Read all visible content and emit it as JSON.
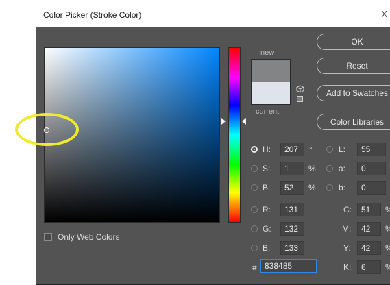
{
  "window": {
    "title": "Color Picker (Stroke Color)",
    "close_glyph": "X"
  },
  "swatches": {
    "new_label": "new",
    "current_label": "current",
    "new_color": "#838485",
    "current_color": "#dfe4ec"
  },
  "buttons": {
    "ok": "OK",
    "reset": "Reset",
    "add_to_swatches": "Add to Swatches",
    "color_libraries": "Color Libraries"
  },
  "hsb": {
    "h": {
      "label": "H:",
      "value": "207",
      "unit": "°",
      "selected": true
    },
    "s": {
      "label": "S:",
      "value": "1",
      "unit": "%"
    },
    "b": {
      "label": "B:",
      "value": "52",
      "unit": "%"
    }
  },
  "lab": {
    "l": {
      "label": "L:",
      "value": "55"
    },
    "a": {
      "label": "a:",
      "value": "0"
    },
    "b": {
      "label": "b:",
      "value": "0"
    }
  },
  "rgb": {
    "r": {
      "label": "R:",
      "value": "131"
    },
    "g": {
      "label": "G:",
      "value": "132"
    },
    "b": {
      "label": "B:",
      "value": "133"
    }
  },
  "cmyk": {
    "c": {
      "label": "C:",
      "value": "51",
      "unit": "%"
    },
    "m": {
      "label": "M:",
      "value": "42",
      "unit": "%"
    },
    "y": {
      "label": "Y:",
      "value": "42",
      "unit": "%"
    },
    "k": {
      "label": "K:",
      "value": "6",
      "unit": "%"
    }
  },
  "hex": {
    "label": "#",
    "value": "838485"
  },
  "only_web_colors": {
    "label": "Only Web Colors",
    "checked": false
  },
  "icons": [
    "close-icon",
    "cube-icon",
    "websafe-swatch-icon"
  ],
  "colors": {
    "dialog_bg": "#535353",
    "hex_focus": "#2d8ae6",
    "annotation_ring": "#f1ea32"
  }
}
